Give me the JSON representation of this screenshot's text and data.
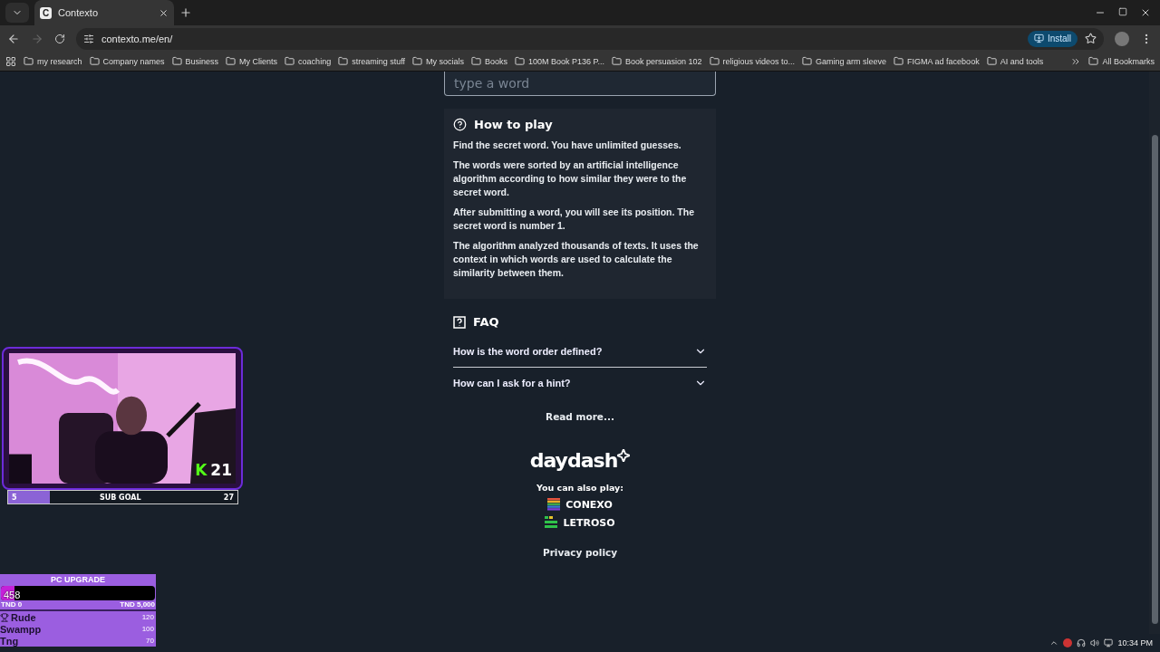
{
  "browser": {
    "tabs": [
      {
        "title": "Contexto",
        "favicon": "C",
        "selected": true
      }
    ],
    "address": "contexto.me/en/",
    "install": "Install",
    "bookmarks": [
      "my research",
      "Company names",
      "Business",
      "My Clients",
      "coaching",
      "streaming stuff",
      "My socials",
      "Books",
      "100M Book P136 P...",
      "Book persuasion 102",
      "religious videos to...",
      "Gaming arm sleeve",
      "FIGMA ad facebook",
      "AI and tools"
    ],
    "all_bookmarks": "All Bookmarks"
  },
  "page": {
    "input": {
      "placeholder": "type a word"
    },
    "how_to_play": {
      "title": "How to play",
      "paragraphs": [
        "Find the secret word. You have unlimited guesses.",
        "The words were sorted by an artificial intelligence algorithm according to how similar they were to the secret word.",
        "After submitting a word, you will see its position. The secret word is number 1.",
        "The algorithm analyzed thousands of texts. It uses the context in which words are used to calculate the similarity between them."
      ]
    },
    "faq": {
      "title": "FAQ",
      "items": [
        {
          "question": "How is the word order defined?",
          "expanded": false
        },
        {
          "question": "How can I ask for a hint?",
          "expanded": false
        }
      ]
    },
    "read_more": "Read more...",
    "brand": "daydash",
    "also_play": "You can also play:",
    "games": [
      {
        "name": "CONEXO",
        "kind": "conexo"
      },
      {
        "name": "LETROSO",
        "kind": "letroso"
      }
    ],
    "privacy": "Privacy policy"
  },
  "overlays": {
    "webcam": {
      "kind": "picture",
      "platform_mark": "K",
      "viewers": "21"
    },
    "sub_goal": {
      "start": "5",
      "label": "SUB GOAL",
      "end": "27",
      "level": 0.18
    },
    "donation": {
      "title": "PC UPGRADE",
      "amount": "458",
      "level": 0.09,
      "min": "TND 0",
      "max": "TND 5,000",
      "leaders": [
        {
          "name": "Rude",
          "amount": "120",
          "top": true
        },
        {
          "name": "Swampp",
          "amount": "100",
          "top": false
        },
        {
          "name": "Tng",
          "amount": "70",
          "top": false
        }
      ]
    }
  },
  "taskbar": {
    "clock": "10:34 PM"
  }
}
